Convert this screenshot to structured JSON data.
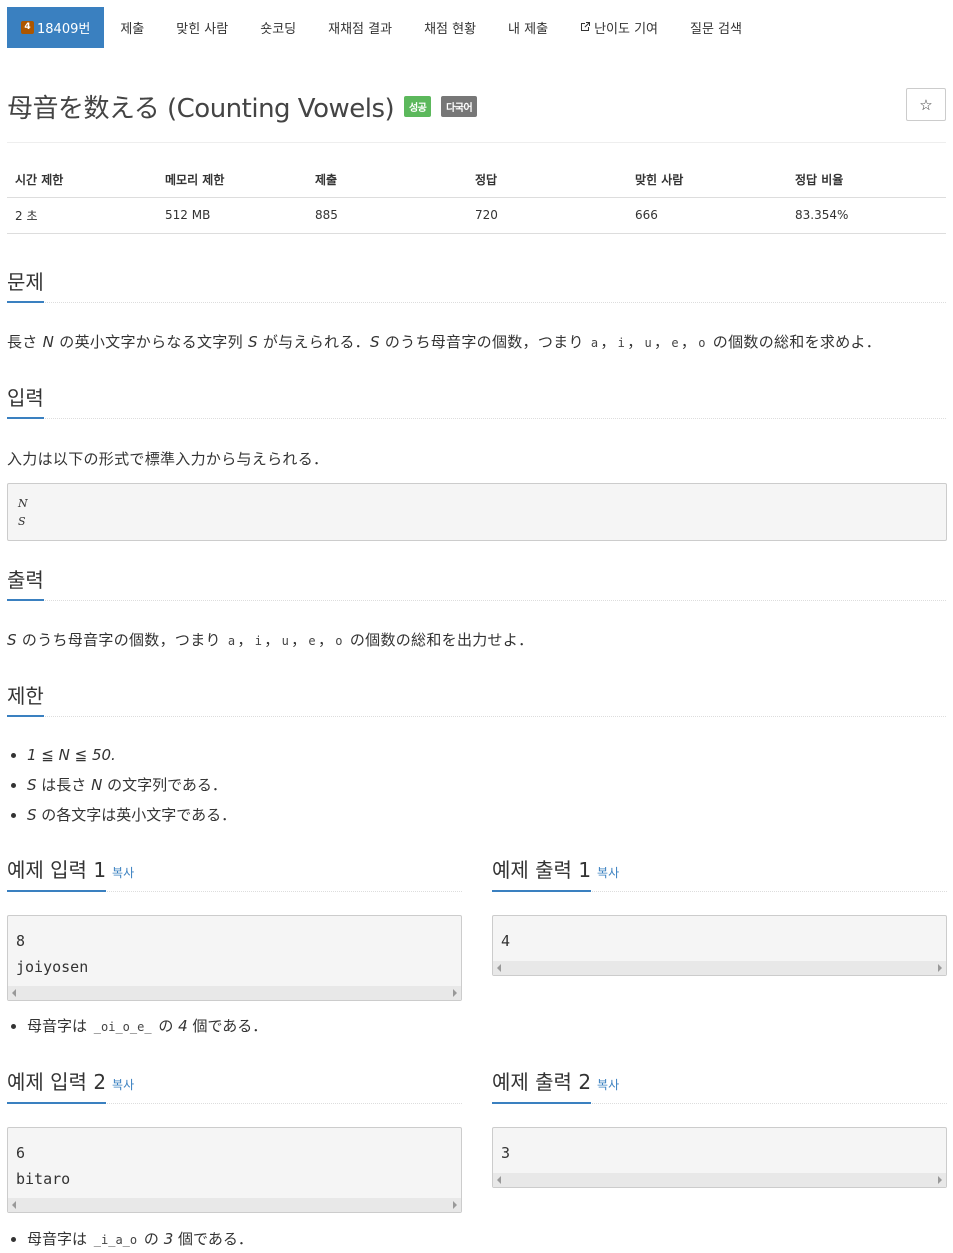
{
  "nav": {
    "tier": "4",
    "problem_id": "18409번",
    "tabs": [
      "제출",
      "맞힌 사람",
      "숏코딩",
      "재채점 결과",
      "채점 현황",
      "내 제출",
      "난이도 기여",
      "질문 검색"
    ]
  },
  "title": "母音を数える (Counting Vowels)",
  "badges": {
    "success": "성공",
    "multi": "다국어"
  },
  "star": "☆",
  "info": {
    "headers": [
      "시간 제한",
      "메모리 제한",
      "제출",
      "정답",
      "맞힌 사람",
      "정답 비율"
    ],
    "values": [
      "2 초",
      "512 MB",
      "885",
      "720",
      "666",
      "83.354%"
    ]
  },
  "sections": {
    "problem": "문제",
    "input": "입력",
    "output": "출력",
    "limits": "제한"
  },
  "problem_text": {
    "p1": "長さ ",
    "N": "N",
    "p2": " の英小文字からなる文字列 ",
    "S": "S",
    "p3": " が与えられる．",
    "S2": "S",
    "p4": " のうち母音字の個数，つまり ",
    "a": "a",
    "comma": "，",
    "i": "i",
    "u": "u",
    "e": "e",
    "o": "o",
    "p5": " の個数の総和を求めよ．"
  },
  "input_text": "入力は以下の形式で標準入力から与えられる．",
  "input_format": [
    "N",
    "S"
  ],
  "output_text": {
    "S": "S",
    "p1": " のうち母音字の個数，つまり ",
    "a": "a",
    "comma": "，",
    "i": "i",
    "u": "u",
    "e": "e",
    "o": "o",
    "p2": " の個数の総和を出力せよ．"
  },
  "limits": {
    "l1": "1 ≦ N ≦ 50.",
    "l2_S": "S",
    "l2_a": " は長さ ",
    "l2_N": "N",
    "l2_b": " の文字列である．",
    "l3_S": "S",
    "l3_a": " の各文字は英小文字である．"
  },
  "samples": [
    {
      "in_title": "예제 입력 1",
      "out_title": "예제 출력 1",
      "copy": "복사",
      "input": [
        "8",
        "joiyosen"
      ],
      "output": [
        "4"
      ],
      "note_a": "母音字は ",
      "note_code": "_oi_o_e_",
      "note_b": " の ",
      "note_num": "4",
      "note_c": " 個である．"
    },
    {
      "in_title": "예제 입력 2",
      "out_title": "예제 출력 2",
      "copy": "복사",
      "input": [
        "6",
        "bitaro"
      ],
      "output": [
        "3"
      ],
      "note_a": "母音字は ",
      "note_code": "_i_a_o",
      "note_b": " の ",
      "note_num": "3",
      "note_c": " 個である．"
    }
  ]
}
